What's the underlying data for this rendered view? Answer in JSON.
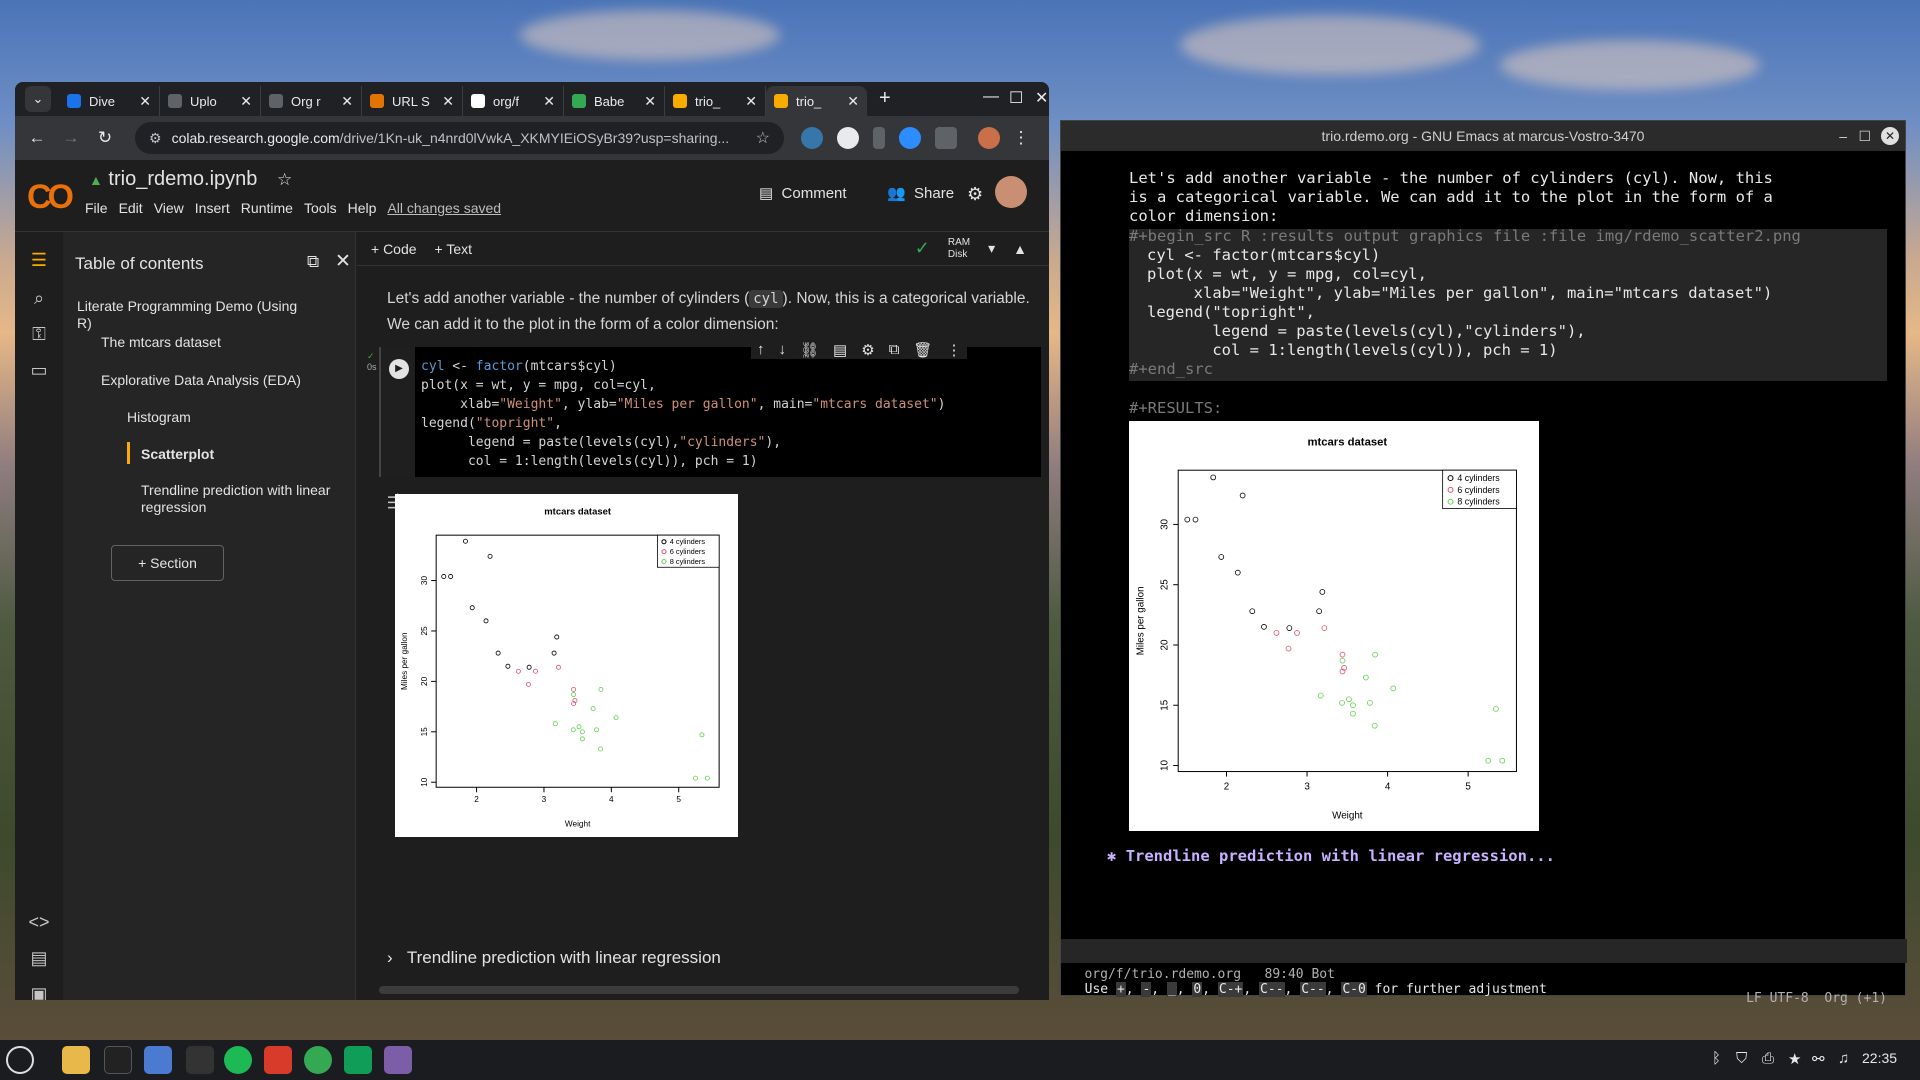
{
  "chrome": {
    "tabs": [
      {
        "title": "Dive",
        "color": "#1a73e8"
      },
      {
        "title": "Uplo",
        "color": "#5f6368"
      },
      {
        "title": "Org r",
        "color": "#5f6368"
      },
      {
        "title": "URL S",
        "color": "#e37400"
      },
      {
        "title": "org/f",
        "color": "#ffffff"
      },
      {
        "title": "Babe",
        "color": "#34a853"
      },
      {
        "title": "trio_",
        "color": "#f9ab00"
      },
      {
        "title": "trio_",
        "color": "#f9ab00"
      }
    ],
    "url_host": "colab.research.google.com",
    "url_path": "/drive/1Kn-uk_n4nrd0lVwkA_XKMYIEiOSyBr39?usp=sharing..."
  },
  "colab": {
    "logo": "CO",
    "title": "trio_rdemo.ipynb",
    "menus": [
      "File",
      "Edit",
      "View",
      "Insert",
      "Runtime",
      "Tools",
      "Help"
    ],
    "saved": "All changes saved",
    "comment": "Comment",
    "share": "Share",
    "ram": "RAM",
    "disk": "Disk",
    "add_code": "+ Code",
    "add_text": "+ Text",
    "toc_header": "Table of contents",
    "toc": [
      "Literate Programming Demo (Using R)",
      "The mtcars dataset",
      "Explorative Data Analysis (EDA)",
      "Histogram",
      "Scatterplot",
      "Trendline prediction with linear regression"
    ],
    "section_btn": "+  Section",
    "text_before": "Let's add another variable - the number of cylinders (",
    "text_code": "cyl",
    "text_after": "). Now, this is a categorical variable. We can add it to the plot in the form of a color dimension:",
    "exec_time": "0s",
    "next_section": "Trendline prediction with linear regression"
  },
  "emacs": {
    "title": "trio.rdemo.org - GNU Emacs at marcus-Vostro-3470",
    "line1": "Let's add another variable - the number of cylinders (cyl). Now, this",
    "line2": "is a categorical variable. We can add it to the plot in the form of a",
    "line3": "color dimension:",
    "src_begin": "#+begin_src R :results output graphics file :file img/rdemo_scatter2.png",
    "src_end": "#+end_src",
    "results": "#+RESULTS:",
    "heading": "Trendline prediction with linear regression...",
    "heading_bullet": "✱",
    "modeline_left": " org/f/trio.rdemo.org   89:40 Bot",
    "modeline_right": "LF UTF-8  Org (+1)",
    "minibuffer_pre": "Use ",
    "minibuffer_keys": [
      "+",
      "-",
      "_",
      "0",
      "C-+",
      "C--",
      "C--",
      "C-0"
    ],
    "minibuffer_post": " for further adjustment"
  },
  "taskbar": {
    "time": "22:35"
  },
  "chart_data": {
    "type": "scatter",
    "title": "mtcars dataset",
    "xlabel": "Weight",
    "ylabel": "Miles per gallon",
    "xlim": [
      1.4,
      5.6
    ],
    "ylim": [
      9.5,
      34.5
    ],
    "xticks": [
      2,
      3,
      4,
      5
    ],
    "yticks": [
      10,
      15,
      20,
      25,
      30
    ],
    "legend_position": "top-right",
    "series": [
      {
        "name": "4 cylinders",
        "color": "#000000",
        "points": [
          [
            2.32,
            22.8
          ],
          [
            3.19,
            24.4
          ],
          [
            3.15,
            22.8
          ],
          [
            2.2,
            32.4
          ],
          [
            1.615,
            30.4
          ],
          [
            1.835,
            33.9
          ],
          [
            2.465,
            21.5
          ],
          [
            1.935,
            27.3
          ],
          [
            2.14,
            26.0
          ],
          [
            1.513,
            30.4
          ],
          [
            2.78,
            21.4
          ]
        ]
      },
      {
        "name": "6 cylinders",
        "color": "#df536b",
        "points": [
          [
            2.62,
            21.0
          ],
          [
            2.875,
            21.0
          ],
          [
            3.215,
            21.4
          ],
          [
            3.46,
            18.1
          ],
          [
            3.44,
            19.2
          ],
          [
            3.44,
            17.8
          ],
          [
            2.77,
            19.7
          ]
        ]
      },
      {
        "name": "8 cylinders",
        "color": "#61d04f",
        "points": [
          [
            3.44,
            18.7
          ],
          [
            3.57,
            14.3
          ],
          [
            4.07,
            16.4
          ],
          [
            3.73,
            17.3
          ],
          [
            3.78,
            15.2
          ],
          [
            5.25,
            10.4
          ],
          [
            5.424,
            10.4
          ],
          [
            5.345,
            14.7
          ],
          [
            3.52,
            15.5
          ],
          [
            3.435,
            15.2
          ],
          [
            3.84,
            13.3
          ],
          [
            3.845,
            19.2
          ],
          [
            3.17,
            15.8
          ],
          [
            3.57,
            15.0
          ]
        ]
      }
    ]
  }
}
